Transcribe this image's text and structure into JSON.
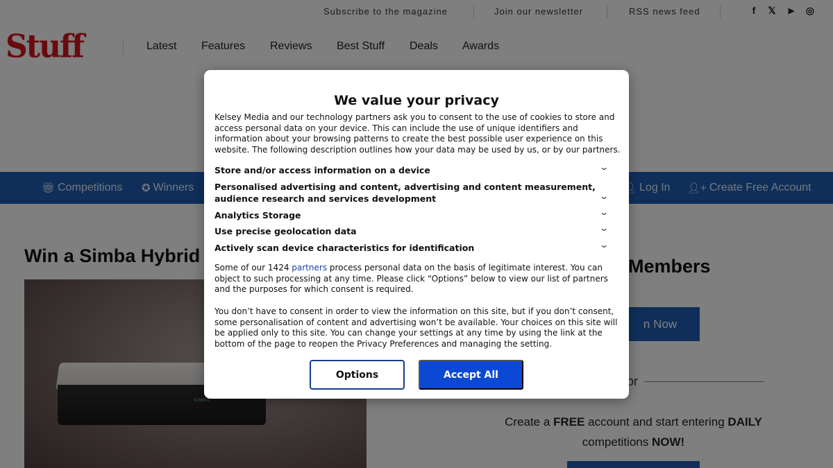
{
  "utility": {
    "subscribe": "Subscribe to the magazine",
    "newsletter": "Join our newsletter",
    "rss": "RSS news feed"
  },
  "social": [
    {
      "name": "facebook",
      "glyph": "f"
    },
    {
      "name": "x",
      "glyph": "𝕏"
    },
    {
      "name": "youtube",
      "glyph": "▶"
    },
    {
      "name": "instagram",
      "glyph": "◎"
    }
  ],
  "header": {
    "logo": "Stuff",
    "nav": [
      "Latest",
      "Features",
      "Reviews",
      "Best Stuff",
      "Deals",
      "Awards"
    ]
  },
  "member_bar": {
    "competitions": "Competitions",
    "winners": "Winners",
    "login": "Log In",
    "create": "Create Free Account"
  },
  "article": {
    "title": "Win a Simba Hybrid",
    "image_brand": "SIMBA"
  },
  "sidebar": {
    "heading": "Members",
    "join_button": "n Now",
    "or": "or",
    "create_line1_a": "Create a ",
    "create_line1_b": "FREE",
    "create_line1_c": " account and start entering ",
    "create_line1_d": "DAILY",
    "create_line2_a": "competitions ",
    "create_line2_b": "NOW!"
  },
  "dialog": {
    "title": "We value your privacy",
    "intro": "Kelsey Media and our technology partners ask you to consent to the use of cookies to store and access personal data on your device. This can include the use of unique identifiers and information about your browsing patterns to create the best possible user experience on this website. The following description outlines how your data may be used by us, or by our partners.",
    "purposes": [
      "Store and/or access information on a device",
      "Personalised advertising and content, advertising and content measurement, audience research and services development",
      "Analytics Storage",
      "Use precise geolocation data",
      "Actively scan device characteristics for identification"
    ],
    "legit_a": "Some of our 1424 ",
    "legit_link": "partners",
    "legit_b": " process personal data on the basis of legitimate interest. You can object to such processing at any time. Please click “Options” below to view our list of partners and the purposes for which consent is required.",
    "consent_text": "You don’t have to consent in order to view the information on this site, but if you don’t consent, some personalisation of content and advertising won’t be available. Your choices on this site will be applied only to this site. You can change your settings at any time by using the link at the bottom of the page to reopen the Privacy Preferences and managing the setting.",
    "options_button": "Options",
    "accept_button": "Accept All"
  }
}
